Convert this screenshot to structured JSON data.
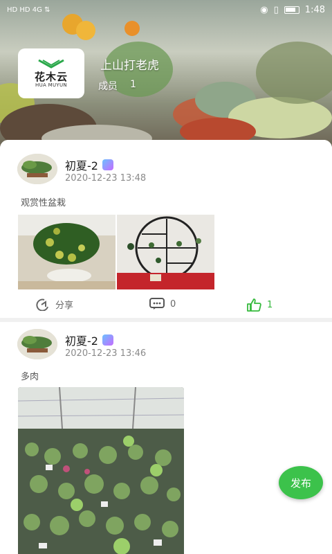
{
  "status_bar": {
    "left": "HD HD 4G ⇅",
    "time": "1:48"
  },
  "header": {
    "logo_cn": "花木云",
    "logo_en": "HUA MUYUN",
    "group_name": "上山打老虎",
    "members_label": "成员",
    "members_count": "1"
  },
  "posts": [
    {
      "user": "初夏-2",
      "time": "2020-12-23 13:48",
      "text": "观赏性盆栽",
      "share_label": "分享",
      "comment_count": "0",
      "like_count": "1"
    },
    {
      "user": "初夏-2",
      "time": "2020-12-23 13:46",
      "text": "多肉"
    }
  ],
  "fab": {
    "label": "发布"
  },
  "colors": {
    "accent": "#3cc24b",
    "like": "#35b93c"
  }
}
